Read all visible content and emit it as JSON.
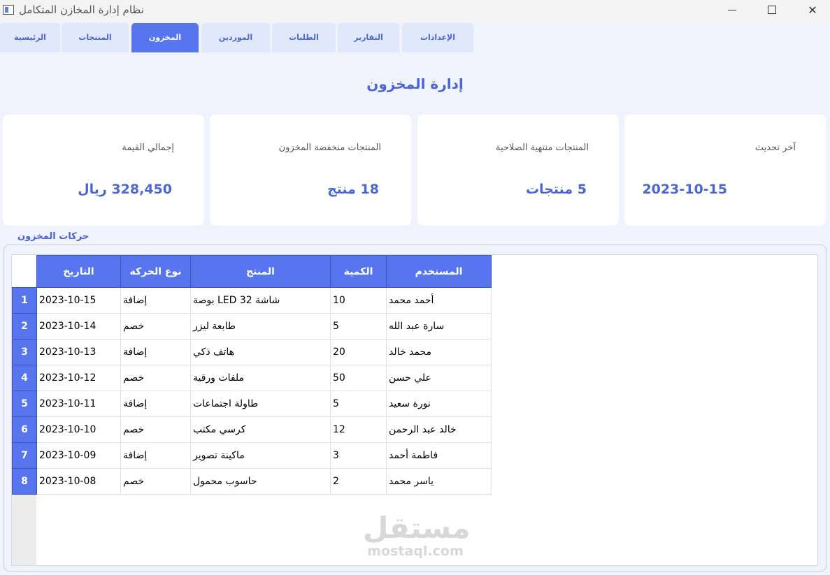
{
  "window": {
    "title": "نظام إدارة المخازن المتكامل"
  },
  "tabs": [
    {
      "label": "الرئيسية",
      "active": false
    },
    {
      "label": "المنتجات",
      "active": false
    },
    {
      "label": "المخزون",
      "active": true
    },
    {
      "label": "الموردين",
      "active": false
    },
    {
      "label": "الطلبات",
      "active": false
    },
    {
      "label": "التقارير",
      "active": false
    },
    {
      "label": "الإعدادات",
      "active": false
    }
  ],
  "page": {
    "title": "إدارة المخزون"
  },
  "cards": [
    {
      "label": "إجمالي القيمة",
      "value": "328,450 ريال"
    },
    {
      "label": "المنتجات منخفضة المخزون",
      "value": "18 منتج"
    },
    {
      "label": "المنتجات منتهية الصلاحية",
      "value": "5 منتجات"
    },
    {
      "label": "آخر تحديث",
      "value": "2023-10-15"
    }
  ],
  "movements": {
    "section_title": "حركات المخزون",
    "columns": [
      "التاريخ",
      "نوع الحركة",
      "المنتج",
      "الكمية",
      "المستخدم"
    ],
    "rows": [
      {
        "n": "1",
        "date": "2023-10-15",
        "type": "إضافة",
        "product": "شاشة LED 32 بوصة",
        "qty": "10",
        "user": "أحمد محمد"
      },
      {
        "n": "2",
        "date": "2023-10-14",
        "type": "خصم",
        "product": "طابعة ليزر",
        "qty": "5",
        "user": "سارة عبد الله"
      },
      {
        "n": "3",
        "date": "2023-10-13",
        "type": "إضافة",
        "product": "هاتف ذكي",
        "qty": "20",
        "user": "محمد خالد"
      },
      {
        "n": "4",
        "date": "2023-10-12",
        "type": "خصم",
        "product": "ملفات ورقية",
        "qty": "50",
        "user": "علي حسن"
      },
      {
        "n": "5",
        "date": "2023-10-11",
        "type": "إضافة",
        "product": "طاولة اجتماعات",
        "qty": "5",
        "user": "نورة سعيد"
      },
      {
        "n": "6",
        "date": "2023-10-10",
        "type": "خصم",
        "product": "كرسي مكتب",
        "qty": "12",
        "user": "خالد عبد الرحمن"
      },
      {
        "n": "7",
        "date": "2023-10-09",
        "type": "إضافة",
        "product": "ماكينة تصوير",
        "qty": "3",
        "user": "فاطمة أحمد"
      },
      {
        "n": "8",
        "date": "2023-10-08",
        "type": "خصم",
        "product": "حاسوب محمول",
        "qty": "2",
        "user": "ياسر محمد"
      }
    ]
  },
  "watermark": {
    "arabic": "مستقل",
    "latin": "mostaql.com"
  }
}
